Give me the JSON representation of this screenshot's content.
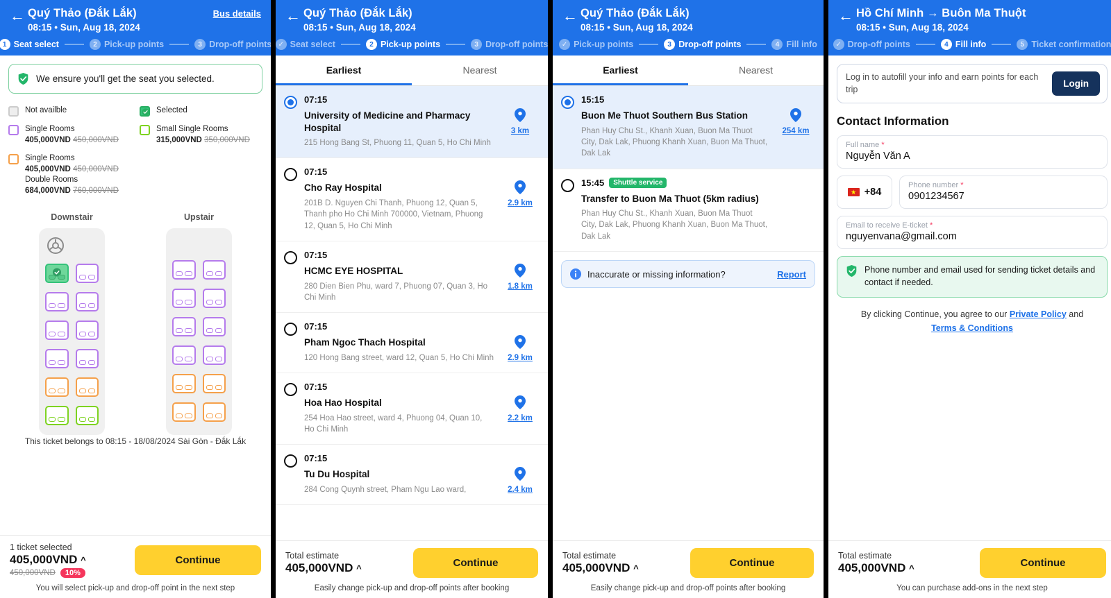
{
  "panel1": {
    "header": {
      "title": "Quý Thảo (Đắk Lắk)",
      "subtitle": "08:15 • Sun, Aug 18, 2024",
      "bus_details": "Bus details",
      "back_icon": "back-arrow-icon",
      "steps": [
        {
          "num": "1",
          "label": "Seat select",
          "state": "active"
        },
        {
          "num": "2",
          "label": "Pick-up points",
          "state": "todo"
        },
        {
          "num": "3",
          "label": "Drop-off points",
          "state": "todo"
        }
      ]
    },
    "ensure_banner": {
      "icon": "shield-check-icon",
      "text": "We ensure you'll get the seat you selected."
    },
    "legend": [
      {
        "type": "unavailable",
        "label": "Not availble",
        "price": "",
        "old_price": "",
        "label2": "",
        "price2": "",
        "old_price2": ""
      },
      {
        "type": "selected",
        "label": "Selected",
        "price": "",
        "old_price": "",
        "label2": "",
        "price2": "",
        "old_price2": ""
      },
      {
        "type": "purple",
        "label": "Single Rooms",
        "price": "405,000VND",
        "old_price": "450,000VND",
        "label2": "",
        "price2": "",
        "old_price2": ""
      },
      {
        "type": "green",
        "label": "Small Single Rooms",
        "price": "315,000VND",
        "old_price": "350,000VND",
        "label2": "",
        "price2": "",
        "old_price2": ""
      },
      {
        "type": "orange",
        "label": "Single Rooms",
        "price": "405,000VND",
        "old_price": "450,000VND",
        "label2": "Double Rooms",
        "price2": "684,000VND",
        "old_price2": "760,000VND"
      }
    ],
    "decks": [
      {
        "name": "Downstair",
        "has_wheel": true,
        "rows": [
          [
            "selected",
            "purple"
          ],
          [
            "purple",
            "purple"
          ],
          [
            "purple",
            "purple"
          ],
          [
            "purple",
            "purple"
          ],
          [
            "orange",
            "orange"
          ],
          [
            "green",
            "green"
          ]
        ]
      },
      {
        "name": "Upstair",
        "has_wheel": false,
        "rows": [
          [
            "purple",
            "purple"
          ],
          [
            "purple",
            "purple"
          ],
          [
            "purple",
            "purple"
          ],
          [
            "purple",
            "purple"
          ],
          [
            "orange",
            "orange"
          ],
          [
            "orange",
            "orange"
          ]
        ]
      }
    ],
    "belongs_note": "This ticket belongs to 08:15 - 18/08/2024 Sài Gòn - Đắk Lắk",
    "bottom": {
      "label": "1 ticket selected",
      "price": "405,000VND",
      "caret": "^",
      "old_price": "450,000VND",
      "discount_badge": "10%",
      "cta": "Continue",
      "note": "You will select pick-up and drop-off point in the next step"
    }
  },
  "panel2": {
    "header": {
      "title": "Quý Thảo (Đắk Lắk)",
      "subtitle": "08:15 • Sun, Aug 18, 2024",
      "back_icon": "back-arrow-icon",
      "steps": [
        {
          "num": "✓",
          "label": "Seat select",
          "state": "done"
        },
        {
          "num": "2",
          "label": "Pick-up points",
          "state": "active"
        },
        {
          "num": "3",
          "label": "Drop-off points",
          "state": "todo"
        }
      ]
    },
    "tabs": [
      {
        "label": "Earliest",
        "selected": true
      },
      {
        "label": "Nearest",
        "selected": false
      }
    ],
    "points": [
      {
        "selected": true,
        "time": "07:15",
        "badge": "",
        "name": "University of Medicine and Pharmacy Hospital",
        "address": "215 Hong Bang St, Phuong 11, Quan 5, Ho Chi Minh",
        "distance": "3 km"
      },
      {
        "selected": false,
        "time": "07:15",
        "badge": "",
        "name": "Cho Ray Hospital",
        "address": "201B D. Nguyen Chi Thanh, Phuong 12, Quan 5, Thanh pho Ho Chi Minh 700000, Vietnam, Phuong 12, Quan 5, Ho Chi Minh",
        "distance": "2.9 km"
      },
      {
        "selected": false,
        "time": "07:15",
        "badge": "",
        "name": "HCMC EYE HOSPITAL",
        "address": "280 Dien Bien Phu, ward 7, Phuong 07, Quan 3, Ho Chi Minh",
        "distance": "1.8 km"
      },
      {
        "selected": false,
        "time": "07:15",
        "badge": "",
        "name": "Pham Ngoc Thach Hospital",
        "address": "120 Hong Bang street, ward 12, Quan 5, Ho Chi Minh",
        "distance": "2.9 km"
      },
      {
        "selected": false,
        "time": "07:15",
        "badge": "",
        "name": "Hoa Hao Hospital",
        "address": "254 Hoa Hao street, ward 4, Phuong 04, Quan 10, Ho Chi Minh",
        "distance": "2.2 km"
      },
      {
        "selected": false,
        "time": "07:15",
        "badge": "",
        "name": "Tu Du Hospital",
        "address": "284 Cong Quynh street, Pham Ngu Lao ward,",
        "distance": "2.4 km"
      }
    ],
    "bottom": {
      "label": "Total estimate",
      "price": "405,000VND",
      "caret": "^",
      "cta": "Continue",
      "note": "Easily change pick-up and drop-off points after booking"
    }
  },
  "panel3": {
    "header": {
      "title": "Quý Thảo (Đắk Lắk)",
      "subtitle": "08:15 • Sun, Aug 18, 2024",
      "back_icon": "back-arrow-icon",
      "steps": [
        {
          "num": "✓",
          "label": "Pick-up points",
          "state": "done"
        },
        {
          "num": "3",
          "label": "Drop-off points",
          "state": "active"
        },
        {
          "num": "4",
          "label": "Fill info",
          "state": "todo"
        }
      ]
    },
    "tabs": [
      {
        "label": "Earliest",
        "selected": true
      },
      {
        "label": "Nearest",
        "selected": false
      }
    ],
    "points": [
      {
        "selected": true,
        "time": "15:15",
        "badge": "",
        "name": "Buon Me Thuot Southern Bus Station",
        "address": "Phan Huy Chu St., Khanh Xuan, Buon Ma Thuot City, Dak Lak, Phuong Khanh Xuan, Buon Ma Thuot, Dak Lak",
        "distance": "254 km"
      },
      {
        "selected": false,
        "time": "15:45",
        "badge": "Shuttle service",
        "name": "Transfer to Buon Ma Thuot (5km radius)",
        "address": "Phan Huy Chu St., Khanh Xuan, Buon Ma Thuot City, Dak Lak, Phuong Khanh Xuan, Buon Ma Thuot, Dak Lak",
        "distance": ""
      }
    ],
    "report": {
      "icon": "info-icon",
      "text": "Inaccurate or missing information?",
      "link": "Report"
    },
    "bottom": {
      "label": "Total estimate",
      "price": "405,000VND",
      "caret": "^",
      "cta": "Continue",
      "note": "Easily change pick-up and drop-off points after booking"
    }
  },
  "panel4": {
    "header": {
      "title": "Hồ Chí Minh → Buôn Ma Thuột",
      "subtitle": "08:15 • Sun, Aug 18, 2024",
      "back_icon": "back-arrow-icon",
      "steps": [
        {
          "num": "✓",
          "label": "Drop-off points",
          "state": "done"
        },
        {
          "num": "4",
          "label": "Fill info",
          "state": "active"
        },
        {
          "num": "5",
          "label": "Ticket confirmation",
          "state": "todo"
        }
      ]
    },
    "login_box": {
      "text": "Log in to autofill your info and earn points for each trip",
      "button": "Login"
    },
    "section_title": "Contact Information",
    "fields": {
      "full_name": {
        "label": "Full name",
        "required": "*",
        "value": "Nguyễn Văn A"
      },
      "country_code": {
        "flag": "vietnam-flag-icon",
        "value": "+84"
      },
      "phone": {
        "label": "Phone number",
        "required": "*",
        "value": "0901234567"
      },
      "email": {
        "label": "Email to receive E-ticket",
        "required": "*",
        "value": "nguyenvana@gmail.com"
      }
    },
    "notice": {
      "icon": "shield-check-icon",
      "text": "Phone number and email used for sending ticket details and contact if needed."
    },
    "terms": {
      "prefix": "By clicking Continue, you agree to our ",
      "link1": "Private Policy",
      "middle": " and ",
      "link2": "Terms & Conditions"
    },
    "bottom": {
      "label": "Total estimate",
      "price": "405,000VND",
      "caret": "^",
      "cta": "Continue",
      "note": "You can purchase add-ons in the next step"
    }
  },
  "colors": {
    "brand_blue": "#1f72e8",
    "cta_yellow": "#ffd02e",
    "green": "#34c27a",
    "purple_seat": "#b57bec",
    "orange_seat": "#f5a04a",
    "green_seat": "#7ed321",
    "discount_red": "#f5365c",
    "login_navy": "#15325c"
  }
}
